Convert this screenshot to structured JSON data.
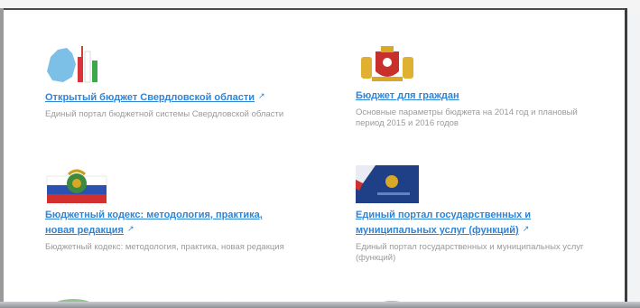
{
  "cards": [
    {
      "title": "Открытый бюджет Свердловской области",
      "ext_icon": "external-link-icon",
      "description": "Единый портал бюджетной системы Свердловской области",
      "icon": "region-map-chart-icon"
    },
    {
      "title": "Бюджет для граждан",
      "description": "Основные параметры бюджета на 2014 год и плановый период 2015 и 2016 годов",
      "icon": "coat-of-arms-icon"
    },
    {
      "title": "Бюджетный кодекс: методология, практика, новая редакция",
      "ext_icon": "external-link-icon",
      "description": "Бюджетный кодекс: методология, практика, новая редакция",
      "icon": "flag-emblem-icon"
    },
    {
      "title": "Единый портал государственных и муниципальных услуг (функций)",
      "ext_icon": "external-link-icon",
      "description": "Единый портал государственных и муниципальных услуг (функций)",
      "icon": "gosuslugi-banner-icon"
    }
  ],
  "colors": {
    "link": "#2f84d6",
    "description": "#9a9a9a",
    "background": "#ffffff"
  }
}
